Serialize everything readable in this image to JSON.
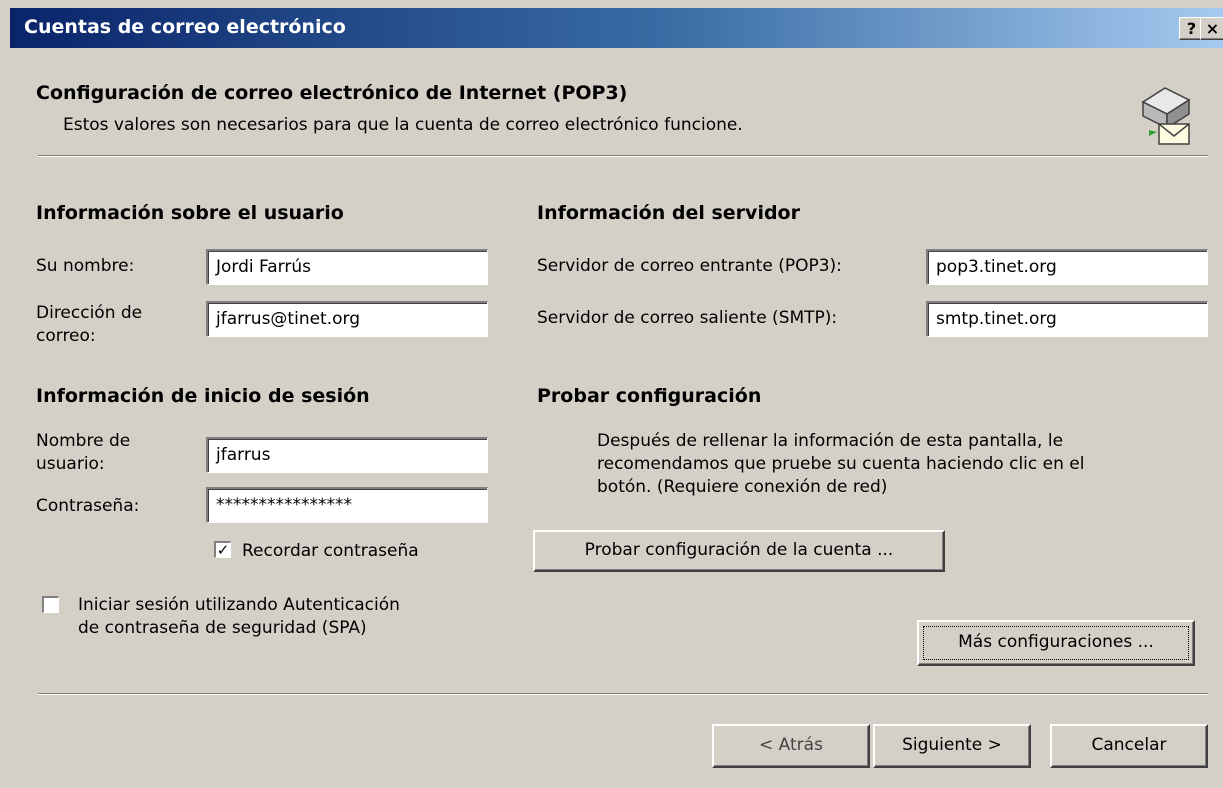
{
  "window": {
    "title": "Cuentas de correo electrónico",
    "help_button": "?",
    "close_button": "×"
  },
  "header": {
    "title": "Configuración de correo electrónico de Internet (POP3)",
    "subtitle": "Estos valores son necesarios para que la cuenta de correo electrónico funcione.",
    "icon": "mail-server-icon"
  },
  "user_info": {
    "heading": "Información sobre el usuario",
    "name_label": "Su nombre:",
    "name_value": "Jordi Farrús",
    "email_label_line1": "Dirección de",
    "email_label_line2": "correo:",
    "email_value": "jfarrus@tinet.org"
  },
  "server_info": {
    "heading": "Información del servidor",
    "incoming_label": "Servidor de correo entrante (POP3):",
    "incoming_value": "pop3.tinet.org",
    "outgoing_label": "Servidor de correo saliente (SMTP):",
    "outgoing_value": "smtp.tinet.org"
  },
  "login_info": {
    "heading": "Información de inicio de sesión",
    "username_label_line1": "Nombre de",
    "username_label_line2": "usuario:",
    "username_value": "jfarrus",
    "password_label": "Contraseña:",
    "password_value": "****************",
    "remember_label": "Recordar contraseña",
    "remember_checked": true,
    "spa_label_line1": "Iniciar sesión utilizando Autenticación",
    "spa_label_line2": "de contraseña de seguridad (SPA)",
    "spa_checked": false
  },
  "test_settings": {
    "heading": "Probar configuración",
    "description_line1": "Después de rellenar la información de esta pantalla, le",
    "description_line2": "recomendamos que pruebe su cuenta haciendo clic en el",
    "description_line3": "botón. (Requiere conexión de red)",
    "test_button": "Probar configuración de la cuenta ..."
  },
  "more_settings_button": "Más configuraciones ...",
  "footer": {
    "back_button": "< Atrás",
    "next_button": "Siguiente >",
    "cancel_button": "Cancelar"
  },
  "colors": {
    "titlebar_start": "#0a246a",
    "titlebar_end": "#a6caf0",
    "dialog_bg": "#d4d0c8"
  }
}
